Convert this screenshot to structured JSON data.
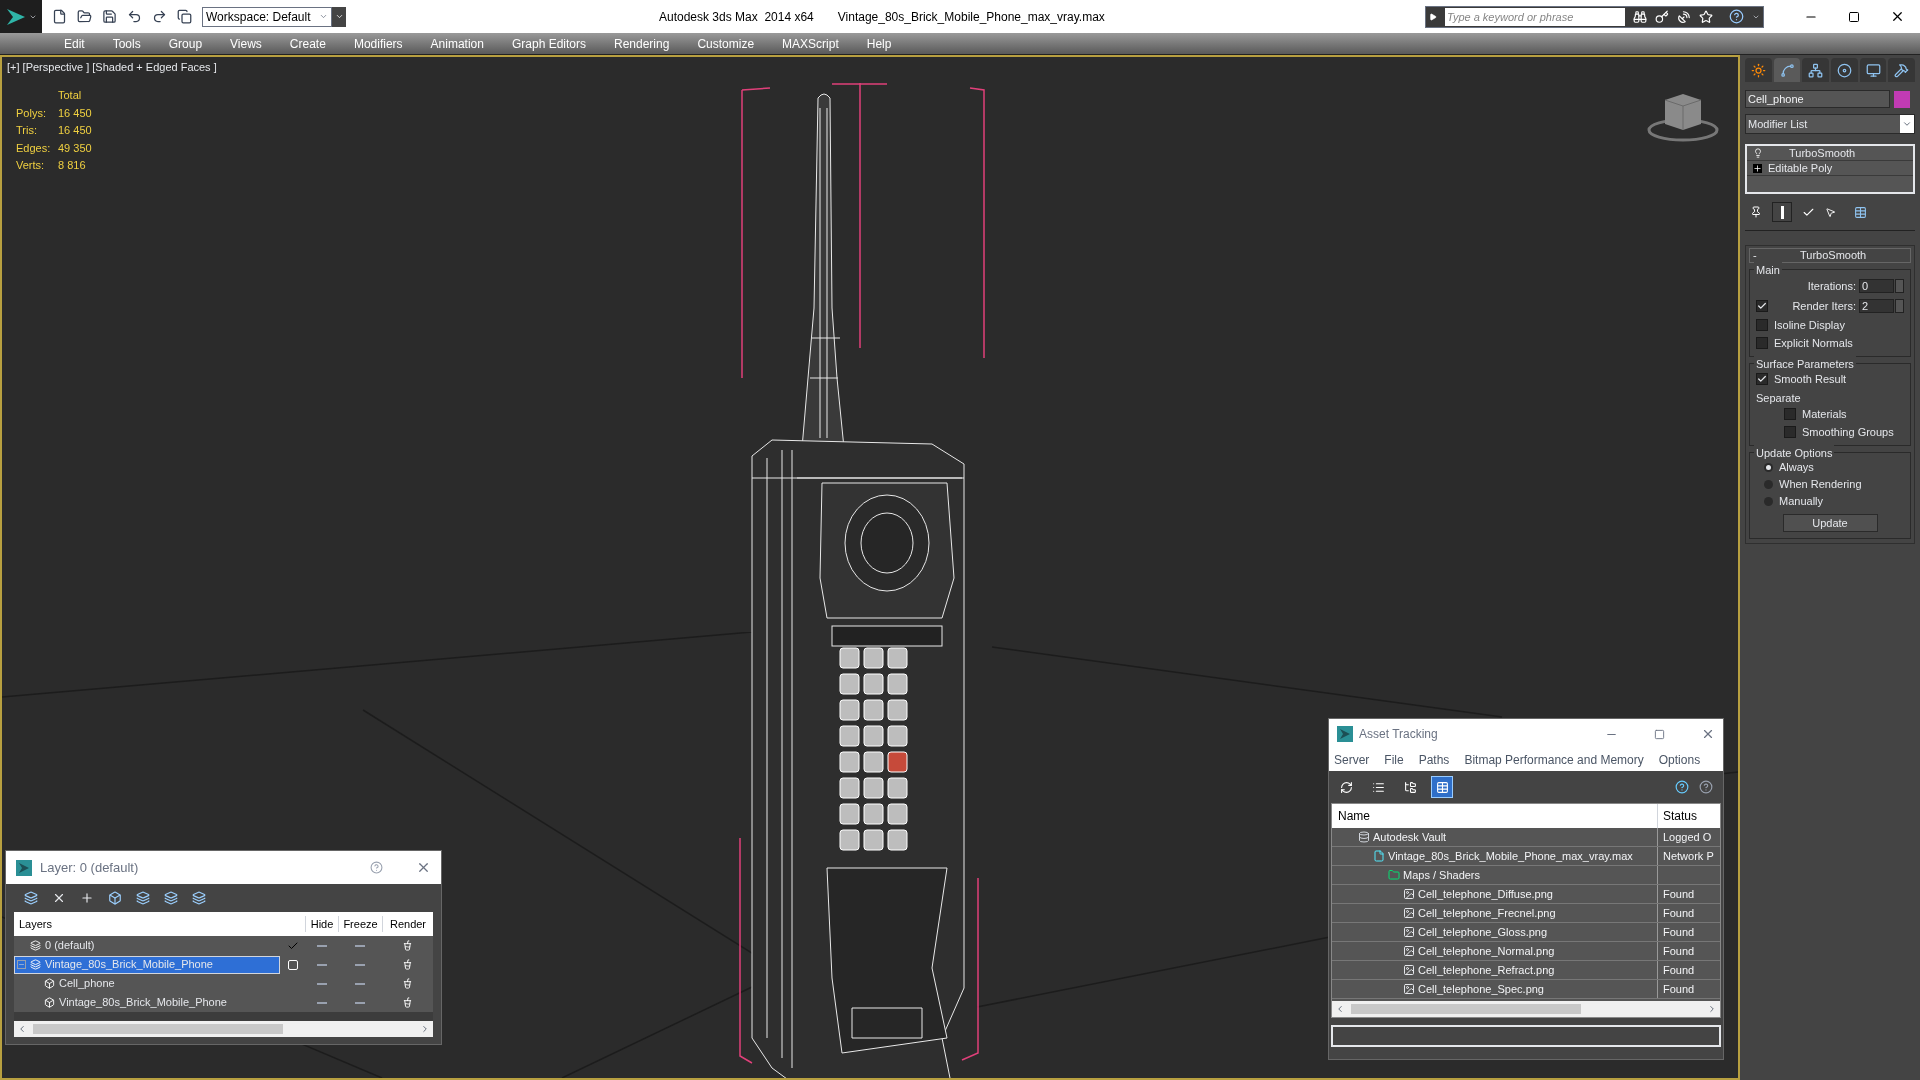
{
  "title_bar": {
    "app_title": "Autodesk 3ds Max  2014 x64",
    "file_name": "Vintage_80s_Brick_Mobile_Phone_max_vray.max",
    "workspace": "Workspace: Default",
    "search": {
      "placeholder": "Type a keyword or phrase"
    }
  },
  "menu": [
    "Edit",
    "Tools",
    "Group",
    "Views",
    "Create",
    "Modifiers",
    "Animation",
    "Graph Editors",
    "Rendering",
    "Customize",
    "MAXScript",
    "Help"
  ],
  "viewport": {
    "label": "[+] [Perspective ] [Shaded + Edged Faces ]",
    "active": true,
    "stats_header": "Total",
    "stats": [
      {
        "label": "Polys:",
        "value": "16 450"
      },
      {
        "label": "Tris:",
        "value": "16 450"
      },
      {
        "label": "Edges:",
        "value": "49 350"
      },
      {
        "label": "Verts:",
        "value": "8 816"
      }
    ]
  },
  "command_panel": {
    "tabs": [
      {
        "kind": "create",
        "selected": false
      },
      {
        "kind": "modify",
        "selected": true
      },
      {
        "kind": "hierarchy",
        "selected": false
      },
      {
        "kind": "motion",
        "selected": false
      },
      {
        "kind": "display",
        "selected": false
      },
      {
        "kind": "utilities",
        "selected": false
      }
    ],
    "object": {
      "name": "Cell_phone",
      "color": "#c13bb4"
    },
    "modifier_list": "Modifier List",
    "stack": [
      {
        "kind": "modifier",
        "label": "TurboSmooth"
      },
      {
        "kind": "base",
        "label": "Editable Poly"
      }
    ],
    "rollout": {
      "title": "TurboSmooth",
      "collapse_sign": "-",
      "groups": [
        {
          "title": "Main",
          "items": [
            {
              "kind": "spinner",
              "label": "Iterations:",
              "value": "0"
            },
            {
              "kind": "spinner",
              "label": "Render Iters:",
              "value": "2",
              "checked": true
            },
            {
              "kind": "checkbox",
              "label": "Isoline Display",
              "checked": false
            },
            {
              "kind": "checkbox",
              "label": "Explicit Normals",
              "checked": false
            }
          ]
        },
        {
          "title": "Surface Parameters",
          "items": [
            {
              "kind": "checkbox",
              "label": "Smooth Result",
              "checked": true
            },
            {
              "kind": "label",
              "label": "Separate"
            },
            {
              "kind": "subcheckbox",
              "label": "Materials",
              "checked": false
            },
            {
              "kind": "subcheckbox",
              "label": "Smoothing Groups",
              "checked": false
            }
          ]
        },
        {
          "title": "Update Options",
          "items": [
            {
              "kind": "radio",
              "label": "Always",
              "selected": true
            },
            {
              "kind": "radio",
              "label": "When Rendering",
              "selected": false
            },
            {
              "kind": "radio",
              "label": "Manually",
              "selected": false
            },
            {
              "kind": "button",
              "label": "Update"
            }
          ]
        }
      ]
    }
  },
  "layer_dialog": {
    "title": "Layer: 0 (default)",
    "columns": {
      "name": "Layers",
      "hide": "Hide",
      "freeze": "Freeze",
      "render": "Render"
    },
    "layers": [
      {
        "kind": "layer",
        "name": "0 (default)",
        "current": true,
        "selected": false
      },
      {
        "kind": "layer",
        "name": "Vintage_80s_Brick_Mobile_Phone",
        "current": false,
        "selected": true,
        "expanded": true,
        "children": [
          {
            "kind": "object",
            "name": "Cell_phone",
            "selected": false
          },
          {
            "kind": "object",
            "name": "Vintage_80s_Brick_Mobile_Phone",
            "selected": false
          }
        ]
      }
    ]
  },
  "asset_tracking": {
    "title": "Asset Tracking",
    "menu": [
      "Server",
      "File",
      "Paths",
      "Bitmap Performance and Memory",
      "Options"
    ],
    "view_buttons": [
      {
        "kind": "refresh",
        "selected": false
      },
      {
        "kind": "list",
        "selected": false
      },
      {
        "kind": "tree",
        "selected": false
      },
      {
        "kind": "table",
        "selected": true
      }
    ],
    "columns": {
      "name": "Name",
      "status": "Status"
    },
    "assets": [
      {
        "kind": "vault",
        "name": "Autodesk Vault",
        "status": "Logged O",
        "children": [
          {
            "kind": "max",
            "name": "Vintage_80s_Brick_Mobile_Phone_max_vray.max",
            "status": "Network P",
            "children": [
              {
                "kind": "folder",
                "name": "Maps / Shaders",
                "children": [
                  {
                    "kind": "bitmap",
                    "name": "Cell_telephone_Diffuse.png",
                    "status": "Found"
                  },
                  {
                    "kind": "bitmap",
                    "name": "Cell_telephone_Frecnel.png",
                    "status": "Found"
                  },
                  {
                    "kind": "bitmap",
                    "name": "Cell_telephone_Gloss.png",
                    "status": "Found"
                  },
                  {
                    "kind": "bitmap",
                    "name": "Cell_telephone_Normal.png",
                    "status": "Found"
                  },
                  {
                    "kind": "bitmap",
                    "name": "Cell_telephone_Refract.png",
                    "status": "Found"
                  },
                  {
                    "kind": "bitmap",
                    "name": "Cell_telephone_Spec.png",
                    "status": "Found"
                  }
                ]
              }
            ]
          }
        ]
      }
    ]
  }
}
